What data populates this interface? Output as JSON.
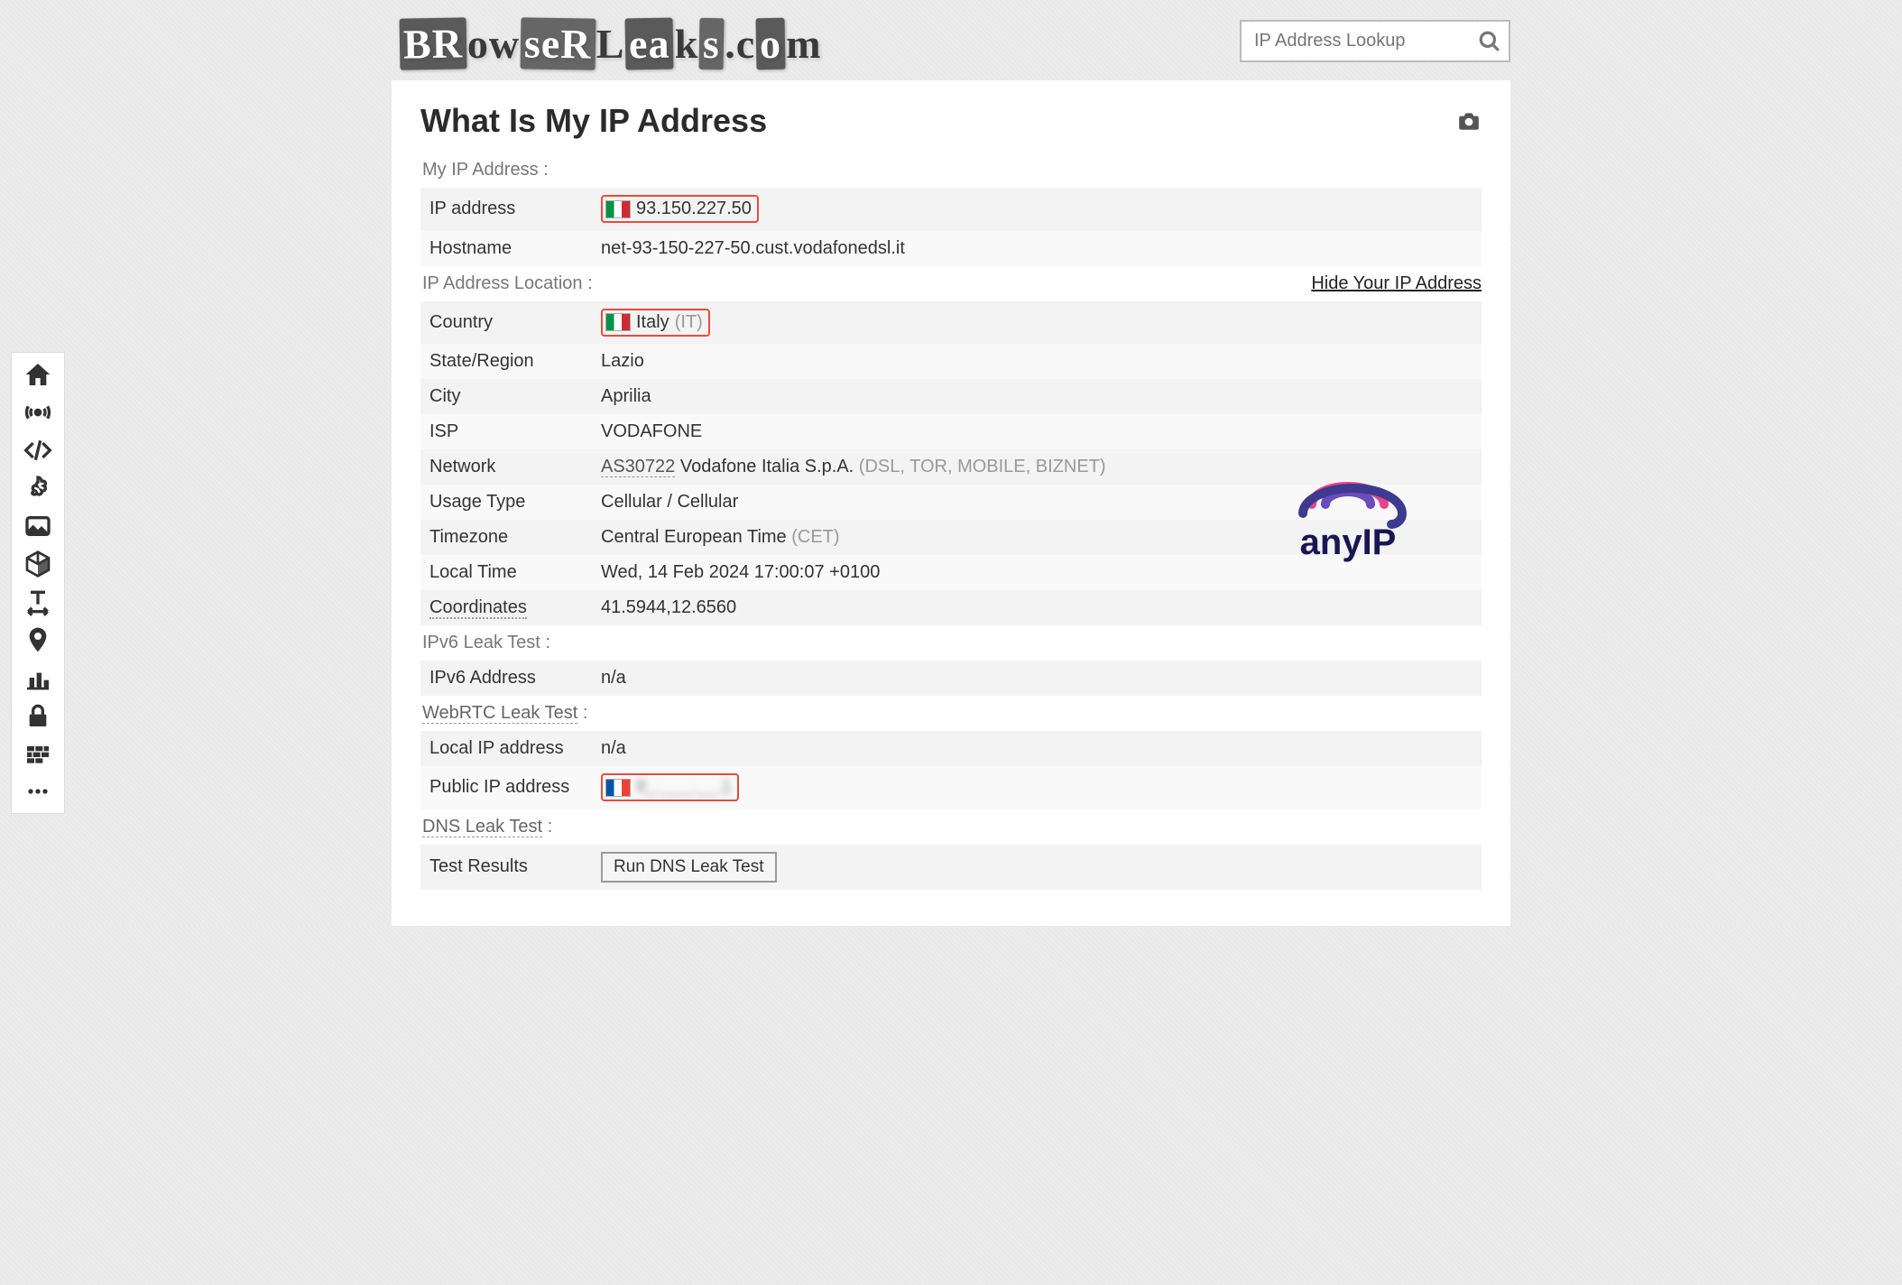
{
  "site": {
    "logo_text": "BRowseRLeaks.com"
  },
  "search": {
    "placeholder": "IP Address Lookup"
  },
  "page": {
    "title": "What Is My IP Address"
  },
  "sections": {
    "my_ip": "My IP Address :",
    "location": "IP Address Location :",
    "ipv6": "IPv6 Leak Test :",
    "webrtc": "WebRTC Leak Test",
    "webrtc_suffix": " :",
    "dns": "DNS Leak Test",
    "dns_suffix": " :"
  },
  "links": {
    "hide_ip": "Hide Your IP Address"
  },
  "rows": {
    "ip_address_label": "IP address",
    "ip_address_value": "93.150.227.50",
    "hostname_label": "Hostname",
    "hostname_value": "net-93-150-227-50.cust.vodafonedsl.it",
    "country_label": "Country",
    "country_value": "Italy",
    "country_code": "(IT)",
    "state_label": "State/Region",
    "state_value": "Lazio",
    "city_label": "City",
    "city_value": "Aprilia",
    "isp_label": "ISP",
    "isp_value": "VODAFONE",
    "network_label": "Network",
    "network_asn": "AS30722",
    "network_name": " Vodafone Italia S.p.A. ",
    "network_extra": "(DSL, TOR, MOBILE, BIZNET)",
    "usage_label": "Usage Type",
    "usage_value": "Cellular / Cellular",
    "timezone_label": "Timezone",
    "timezone_value": "Central European Time ",
    "timezone_code": "(CET)",
    "localtime_label": "Local Time",
    "localtime_value": "Wed, 14 Feb 2024 17:00:07 +0100",
    "coords_label": "Coordinates",
    "coords_value": "41.5944,12.6560",
    "ipv6addr_label": "IPv6 Address",
    "ipv6addr_value": "n/a",
    "localip_label": "Local IP address",
    "localip_value": "n/a",
    "publicip_label": "Public IP address",
    "publicip_value": "8_.___.__.1",
    "testresults_label": "Test Results",
    "dns_button": "Run DNS Leak Test"
  },
  "ad": {
    "text": "anyIP"
  }
}
